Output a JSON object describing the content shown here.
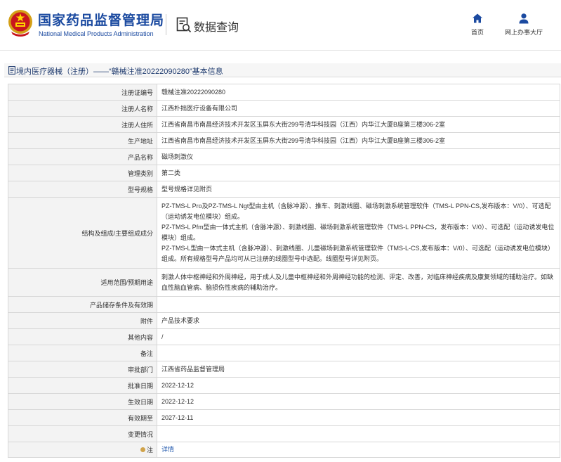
{
  "header": {
    "org_name_cn": "国家药品监督管理局",
    "org_name_en": "National Medical Products Administration",
    "section_title": "数据查询",
    "nav": [
      {
        "label": "首页",
        "icon": "home-icon"
      },
      {
        "label": "网上办事大厅",
        "icon": "user-icon"
      }
    ]
  },
  "breadcrumb": {
    "title": "境内医疗器械（注册）——“赣械注准20222090280”基本信息"
  },
  "record": {
    "rows": [
      {
        "label": "注册证编号",
        "value": "赣械注准20222090280"
      },
      {
        "label": "注册人名称",
        "value": "江西朴拙医疗设备有限公司"
      },
      {
        "label": "注册人住所",
        "value": "江西省南昌市南昌经济技术开发区玉屏东大街299号清华科技园（江西）内华江大厦B座第三楼306-2室"
      },
      {
        "label": "生产地址",
        "value": "江西省南昌市南昌经济技术开发区玉屏东大街299号清华科技园（江西）内华江大厦B座第三楼306-2室"
      },
      {
        "label": "产品名称",
        "value": "磁场刺激仪"
      },
      {
        "label": "管理类别",
        "value": "第二类"
      },
      {
        "label": "型号规格",
        "value": "型号规格详见附页"
      },
      {
        "label": "结构及组成/主要组成成分",
        "paragraphs": [
          "PZ-TMS-L Pro及PZ-TMS-L Ngt型由主机（含脉冲源）、推车、刺激线圈、磁场刺激系统管理软件（TMS-L PPN-CS,发布版本：V/0）、可选配（运动诱发电位模块）组成。",
          "PZ-TMS-L Pfm型由一体式主机（含脉冲源）、刺激线圈、磁场刺激系统管理软件（TMS-L PPN-CS，发布版本：V/0）、可选配（运动诱发电位模块）组成。",
          "PZ-TMS-L型由一体式主机（含脉冲源）、刺激线圈、儿童磁场刺激系统管理软件（TMS-L-CS,发布版本：V/0）、可选配（运动诱发电位模块）组成。所有规格型号产品均可从已注册的线圈型号中选配。线圈型号详见附页。"
        ]
      },
      {
        "label": "适用范围/预期用途",
        "value": "刺激人体中枢神经和外周神经，用于成人及儿童中枢神经和外周神经功能的检测、评定、改善，对临床神经疾病及康复领域的辅助治疗。如缺血性脑血管病、脑损伤性疾病的辅助治疗。"
      },
      {
        "label": "产品储存条件及有效期",
        "value": ""
      },
      {
        "label": "附件",
        "value": "产品技术要求"
      },
      {
        "label": "其他内容",
        "value": "/"
      },
      {
        "label": "备注",
        "value": ""
      },
      {
        "label": "审批部门",
        "value": "江西省药品监督管理局"
      },
      {
        "label": "批准日期",
        "value": "2022-12-12"
      },
      {
        "label": "生效日期",
        "value": "2022-12-12"
      },
      {
        "label": "有效期至",
        "value": "2027-12-11"
      },
      {
        "label": "变更情况",
        "value": ""
      },
      {
        "label": "注",
        "value": "详情"
      }
    ]
  }
}
